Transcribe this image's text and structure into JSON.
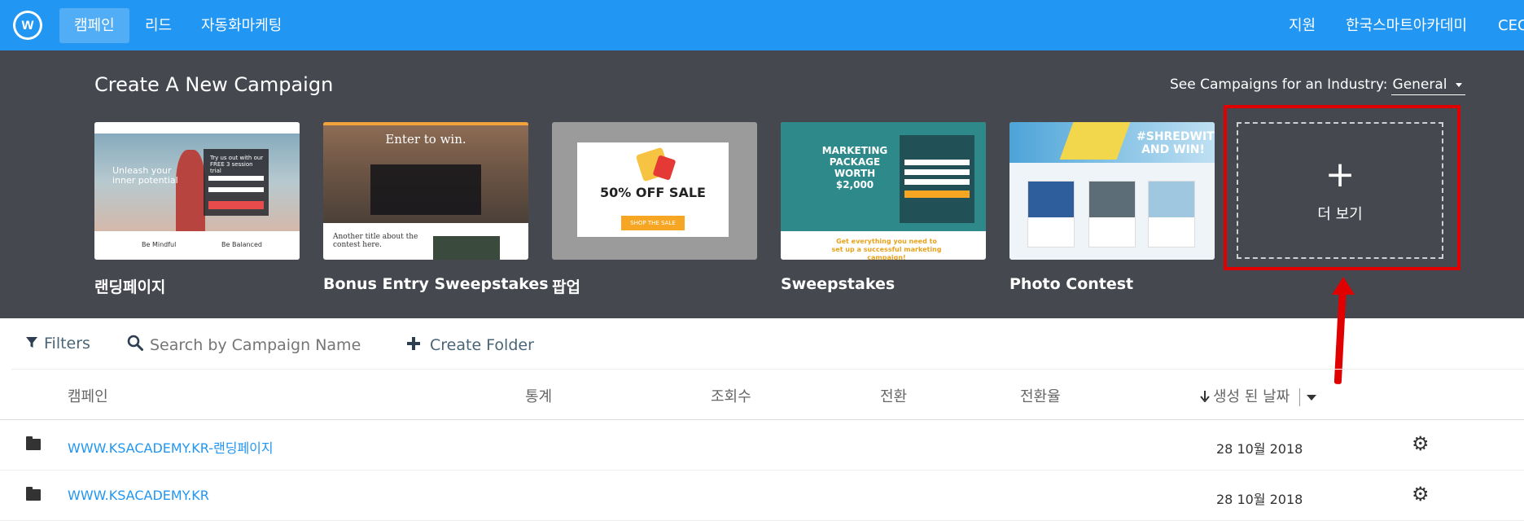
{
  "topnav": {
    "logo_letter": "w",
    "items": [
      {
        "label": "캠페인",
        "active": true
      },
      {
        "label": "리드",
        "active": false
      },
      {
        "label": "자동화마케팅",
        "active": false
      }
    ],
    "right_items": [
      "지원",
      "한국스마트아카데미",
      "CEO"
    ]
  },
  "create": {
    "title": "Create A New Campaign",
    "industry_label": "See Campaigns for an Industry:",
    "industry_value": "General",
    "templates": [
      {
        "label": "랜딩페이지"
      },
      {
        "label": "Bonus Entry Sweepstakes"
      },
      {
        "label": "팝업"
      },
      {
        "label": "Sweepstakes"
      },
      {
        "label": "Photo Contest"
      }
    ],
    "more_label": "더 보기",
    "more_plus": "+",
    "previews": {
      "landing": {
        "headline": "Unleash your inner potential",
        "trial": "Try us out with our FREE 3 session trial",
        "col1": "Be Mindful",
        "col2": "Be Balanced"
      },
      "bonus": {
        "title": "Enter to win.",
        "subtitle": "Another title about the contest here."
      },
      "popup": {
        "sale": "50% OFF SALE",
        "button": "SHOP THE SALE"
      },
      "sweep": {
        "headline": "MARKETING PACKAGE WORTH $2,000",
        "tagline": "Get everything you need to set up a successful marketing campaign!"
      },
      "photo": {
        "headline": "#SHREDWITHPOWDER AND WIN!"
      }
    }
  },
  "toolbar": {
    "filters_label": "Filters",
    "search_placeholder": "Search by Campaign Name",
    "create_folder_label": "Create Folder"
  },
  "table": {
    "headers": {
      "campaign": "캠페인",
      "stats": "통계",
      "views": "조회수",
      "conversions": "전환",
      "conversion_rate": "전환율",
      "created": "생성 된 날짜"
    },
    "rows": [
      {
        "name": "WWW.KSACADEMY.KR-랜딩페이지",
        "date": "28 10월 2018"
      },
      {
        "name": "WWW.KSACADEMY.KR",
        "date": "28 10월 2018"
      }
    ]
  },
  "colors": {
    "brand_blue": "#2196f3",
    "dark_band": "#464850",
    "highlight_red": "#e00000"
  }
}
